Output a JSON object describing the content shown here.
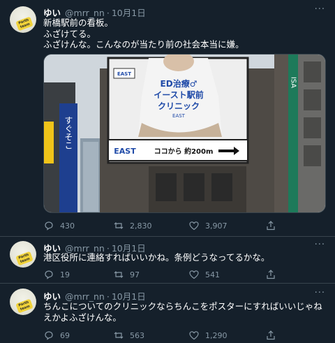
{
  "tweets": [
    {
      "name": "ゆい",
      "handle": "@mrr_nn",
      "date": "10月1日",
      "text": "新橋駅前の看板。\nふざけてる。\nふざけんな。こんなのが当たり前の社会本当に嫌。",
      "replies": "430",
      "retweets": "2,830",
      "likes": "3,907"
    },
    {
      "name": "ゆい",
      "handle": "@mrr_nn",
      "date": "10月1日",
      "text": "港区役所に連絡すればいいかね。条例どうなってるかな。",
      "replies": "19",
      "retweets": "97",
      "likes": "541"
    },
    {
      "name": "ゆい",
      "handle": "@mrr_nn",
      "date": "10月1日",
      "text": "ちんこについてのクリニックならちんこをポスターにすればいいじゃねえかよふざけんな。",
      "replies": "69",
      "retweets": "563",
      "likes": "1,290"
    }
  ],
  "avatar_sticker": "Parth\nteam",
  "billboard": {
    "brand_small": "EAST",
    "headline1": "ED治療♂",
    "headline2": "イースト駅前",
    "headline3": "クリニック",
    "brand": "EAST",
    "bottom_brand": "EAST",
    "direction": "ココから 約200m",
    "side_sign": "すぐそこ",
    "right_sign": "ISA"
  },
  "colors": {
    "background": "#15202b",
    "divider": "#38444d",
    "muted": "#8899a6",
    "text": "#ffffff"
  }
}
